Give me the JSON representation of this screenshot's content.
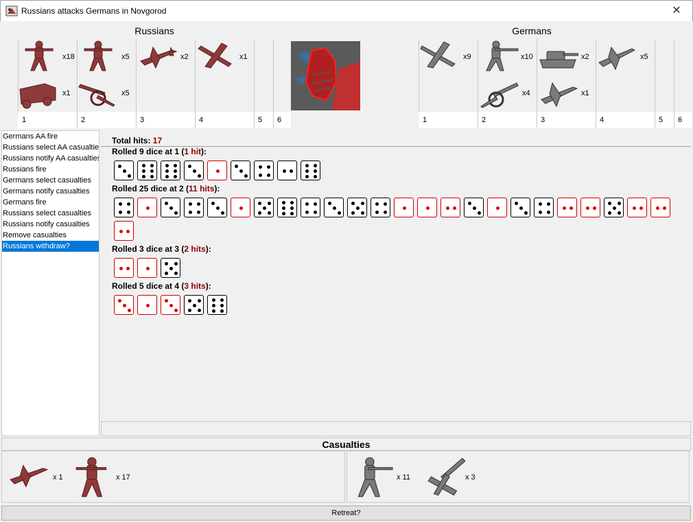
{
  "window": {
    "title": "Russians attacks Germans in Novgorod",
    "close_glyph": "✕"
  },
  "colors": {
    "russian": "#8e3a3a",
    "german": "#6e6e6e",
    "hit": "#d00000",
    "selected": "#0078d7",
    "dark_red_text": "#8b0000"
  },
  "attacker": {
    "name": "Russians",
    "units": [
      {
        "icon": "infantry-icon",
        "count": "x18"
      },
      {
        "icon": "truck-icon",
        "count": "x1"
      },
      {
        "icon": "infantry-icon",
        "count": "x5"
      },
      {
        "icon": "artillery-icon",
        "count": "x5"
      },
      {
        "icon": "fighter-icon",
        "count": "x2"
      },
      {
        "icon": "bomber-icon",
        "count": "x1"
      }
    ],
    "columns": [
      "1",
      "2",
      "3",
      "4",
      "5",
      "6"
    ]
  },
  "defender": {
    "name": "Germans",
    "units": [
      {
        "icon": "bomber-icon",
        "count": "x9"
      },
      {
        "icon": "infantry-icon",
        "count": "x10"
      },
      {
        "icon": "artillery-icon",
        "count": "x4"
      },
      {
        "icon": "tank-icon",
        "count": "x2"
      },
      {
        "icon": "tactical-bomber-icon",
        "count": "x1"
      },
      {
        "icon": "fighter-icon",
        "count": "x5"
      }
    ],
    "columns": [
      "1",
      "2",
      "3",
      "4",
      "5",
      "6"
    ]
  },
  "steps": [
    "Germans AA fire",
    "Russians select AA casualties",
    "Russians notify AA casualties",
    "Russians fire",
    "Germans select casualties",
    "Germans notify casualties",
    "Germans fire",
    "Russians select casualties",
    "Russians notify casualties",
    "Remove casualties",
    "Russians withdraw?"
  ],
  "selected_step": 10,
  "total_hits": {
    "label": "Total hits:",
    "value": "17"
  },
  "rolls": [
    {
      "prefix": "Rolled 9 dice at 1 (",
      "hits": "1 hit",
      "suffix": "):",
      "dice": [
        3,
        6,
        6,
        3,
        1,
        3,
        4,
        2,
        6
      ],
      "hit_flags": [
        0,
        0,
        0,
        0,
        1,
        0,
        0,
        0,
        0
      ]
    },
    {
      "prefix": "Rolled 25 dice at 2 (",
      "hits": "11 hits",
      "suffix": "):",
      "dice": [
        4,
        1,
        3,
        4,
        3,
        1,
        5,
        6,
        4,
        3,
        5,
        4,
        1,
        1,
        2,
        3,
        1,
        3,
        4,
        2,
        2,
        5,
        2,
        2,
        2
      ],
      "hit_flags": [
        0,
        1,
        0,
        0,
        0,
        1,
        0,
        0,
        0,
        0,
        0,
        0,
        1,
        1,
        1,
        0,
        1,
        0,
        0,
        1,
        1,
        0,
        1,
        1,
        1
      ]
    },
    {
      "prefix": "Rolled 3 dice at 3 (",
      "hits": "2 hits",
      "suffix": "):",
      "dice": [
        2,
        1,
        5
      ],
      "hit_flags": [
        1,
        1,
        0
      ]
    },
    {
      "prefix": "Rolled 5 dice at 4 (",
      "hits": "3 hits",
      "suffix": "):",
      "dice": [
        3,
        1,
        3,
        5,
        6
      ],
      "hit_flags": [
        1,
        1,
        1,
        0,
        0
      ]
    }
  ],
  "casualties": {
    "title": "Casualties",
    "attacker": [
      {
        "icon": "fighter-icon",
        "count": "x 1"
      },
      {
        "icon": "infantry-icon",
        "count": "x 17"
      }
    ],
    "defender": [
      {
        "icon": "infantry-icon",
        "count": "x 11"
      },
      {
        "icon": "artillery-icon",
        "count": "x 3"
      }
    ]
  },
  "retreat_label": "Retreat?"
}
